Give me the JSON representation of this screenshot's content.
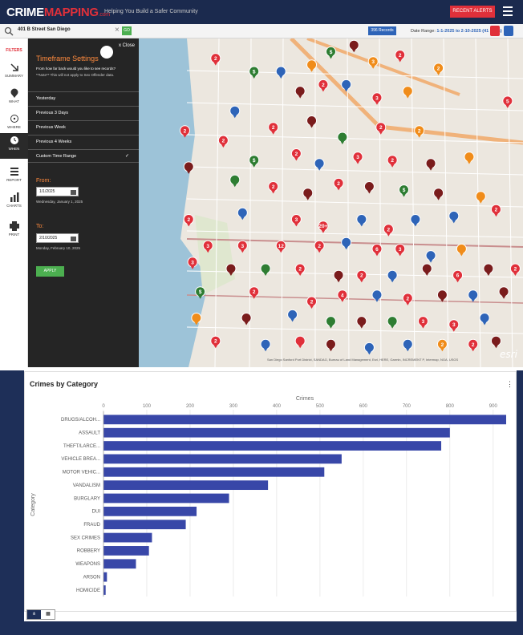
{
  "header": {
    "logo_crime": "CRIME",
    "logo_mapping": "MAPPING",
    "logo_com": ".com",
    "tagline": "Helping You Build a Safer Community",
    "recent_alerts_label": "RECENT ALERTS"
  },
  "search": {
    "value": "401 B Street San Diego",
    "clear": "×",
    "go_label": "GO",
    "records_label": "396 Records",
    "date_range_label": "Date Range:",
    "date_range_value": "1-1-2025 to 2-10-2025 (41 Days)"
  },
  "nav": {
    "filters": "FILTERS",
    "summary": "SUMMARY",
    "what": "WHAT",
    "where": "WHERE",
    "when": "WHEN",
    "report": "REPORT",
    "charts": "CHARTS",
    "print": "PRINT"
  },
  "timeframe": {
    "title": "Timeframe Settings",
    "close": "x Close",
    "question": "From how far back would you like to see records?",
    "note": "**Note** This will not apply to Sex Offender data.",
    "options": [
      "Yesterday",
      "Previous 3 Days",
      "Previous Week",
      "Previous 4 Weeks",
      "Custom Time Range"
    ],
    "check": "✓",
    "from_label": "From:",
    "from_value": "1/1/2025",
    "from_desc": "Wednesday, January 1, 2025",
    "to_label": "To:",
    "to_value": "2/10/2025",
    "to_desc": "Monday, February 10, 2025",
    "apply_label": "APPLY"
  },
  "map": {
    "attribution": "San Diego Sanford Port District, SANDAG, Bureau of Land Management, Esri, HERE, Garmin, INCREMENT P, Intermap, NGA, USGS",
    "esri": "esri",
    "markers": [
      {
        "x": 0.2,
        "y": 0.06,
        "c": "#e0303a",
        "t": "2"
      },
      {
        "x": 0.3,
        "y": 0.1,
        "c": "#2e7d32",
        "t": "$"
      },
      {
        "x": 0.37,
        "y": 0.1,
        "c": "#2e64b8",
        "t": ""
      },
      {
        "x": 0.45,
        "y": 0.08,
        "c": "#f08c1a",
        "t": ""
      },
      {
        "x": 0.5,
        "y": 0.04,
        "c": "#2e7d32",
        "t": "$"
      },
      {
        "x": 0.56,
        "y": 0.02,
        "c": "#7a1c1c",
        "t": ""
      },
      {
        "x": 0.61,
        "y": 0.07,
        "c": "#f08c1a",
        "t": "3"
      },
      {
        "x": 0.68,
        "y": 0.05,
        "c": "#e0303a",
        "t": "2"
      },
      {
        "x": 0.42,
        "y": 0.16,
        "c": "#7a1c1c",
        "t": ""
      },
      {
        "x": 0.48,
        "y": 0.14,
        "c": "#e0303a",
        "t": "2"
      },
      {
        "x": 0.54,
        "y": 0.14,
        "c": "#2e64b8",
        "t": ""
      },
      {
        "x": 0.62,
        "y": 0.18,
        "c": "#e0303a",
        "t": "3"
      },
      {
        "x": 0.7,
        "y": 0.16,
        "c": "#f08c1a",
        "t": ""
      },
      {
        "x": 0.78,
        "y": 0.09,
        "c": "#f08c1a",
        "t": "2"
      },
      {
        "x": 0.96,
        "y": 0.19,
        "c": "#e0303a",
        "t": "5"
      },
      {
        "x": 0.25,
        "y": 0.22,
        "c": "#2e64b8",
        "t": ""
      },
      {
        "x": 0.35,
        "y": 0.27,
        "c": "#e0303a",
        "t": "2"
      },
      {
        "x": 0.45,
        "y": 0.25,
        "c": "#7a1c1c",
        "t": ""
      },
      {
        "x": 0.53,
        "y": 0.3,
        "c": "#2e7d32",
        "t": ""
      },
      {
        "x": 0.63,
        "y": 0.27,
        "c": "#e0303a",
        "t": "2"
      },
      {
        "x": 0.73,
        "y": 0.28,
        "c": "#f08c1a",
        "t": "2"
      },
      {
        "x": 0.12,
        "y": 0.28,
        "c": "#e0303a",
        "t": "2"
      },
      {
        "x": 0.22,
        "y": 0.31,
        "c": "#e0303a",
        "t": "2"
      },
      {
        "x": 0.3,
        "y": 0.37,
        "c": "#2e7d32",
        "t": "$"
      },
      {
        "x": 0.41,
        "y": 0.35,
        "c": "#e0303a",
        "t": "2"
      },
      {
        "x": 0.47,
        "y": 0.38,
        "c": "#2e64b8",
        "t": ""
      },
      {
        "x": 0.57,
        "y": 0.36,
        "c": "#e0303a",
        "t": "3"
      },
      {
        "x": 0.66,
        "y": 0.37,
        "c": "#e0303a",
        "t": "2"
      },
      {
        "x": 0.76,
        "y": 0.38,
        "c": "#7a1c1c",
        "t": ""
      },
      {
        "x": 0.86,
        "y": 0.36,
        "c": "#f08c1a",
        "t": ""
      },
      {
        "x": 0.13,
        "y": 0.39,
        "c": "#7a1c1c",
        "t": ""
      },
      {
        "x": 0.25,
        "y": 0.43,
        "c": "#2e7d32",
        "t": ""
      },
      {
        "x": 0.35,
        "y": 0.45,
        "c": "#e0303a",
        "t": "2"
      },
      {
        "x": 0.44,
        "y": 0.47,
        "c": "#7a1c1c",
        "t": ""
      },
      {
        "x": 0.52,
        "y": 0.44,
        "c": "#e0303a",
        "t": "2"
      },
      {
        "x": 0.6,
        "y": 0.45,
        "c": "#7a1c1c",
        "t": ""
      },
      {
        "x": 0.69,
        "y": 0.46,
        "c": "#2e7d32",
        "t": "$"
      },
      {
        "x": 0.78,
        "y": 0.47,
        "c": "#7a1c1c",
        "t": ""
      },
      {
        "x": 0.89,
        "y": 0.48,
        "c": "#f08c1a",
        "t": ""
      },
      {
        "x": 0.27,
        "y": 0.53,
        "c": "#2e64b8",
        "t": ""
      },
      {
        "x": 0.41,
        "y": 0.55,
        "c": "#e0303a",
        "t": "3"
      },
      {
        "x": 0.48,
        "y": 0.57,
        "c": "#e0303a",
        "t": "20+"
      },
      {
        "x": 0.58,
        "y": 0.55,
        "c": "#2e64b8",
        "t": ""
      },
      {
        "x": 0.65,
        "y": 0.58,
        "c": "#e0303a",
        "t": "2"
      },
      {
        "x": 0.72,
        "y": 0.55,
        "c": "#2e64b8",
        "t": ""
      },
      {
        "x": 0.82,
        "y": 0.54,
        "c": "#2e64b8",
        "t": ""
      },
      {
        "x": 0.93,
        "y": 0.52,
        "c": "#e0303a",
        "t": "2"
      },
      {
        "x": 0.13,
        "y": 0.55,
        "c": "#e0303a",
        "t": "2"
      },
      {
        "x": 0.18,
        "y": 0.63,
        "c": "#e0303a",
        "t": "3"
      },
      {
        "x": 0.27,
        "y": 0.63,
        "c": "#e0303a",
        "t": "3"
      },
      {
        "x": 0.37,
        "y": 0.63,
        "c": "#e0303a",
        "t": "12"
      },
      {
        "x": 0.47,
        "y": 0.63,
        "c": "#e0303a",
        "t": "2"
      },
      {
        "x": 0.54,
        "y": 0.62,
        "c": "#2e64b8",
        "t": ""
      },
      {
        "x": 0.62,
        "y": 0.64,
        "c": "#e0303a",
        "t": "6"
      },
      {
        "x": 0.68,
        "y": 0.64,
        "c": "#e0303a",
        "t": "3"
      },
      {
        "x": 0.76,
        "y": 0.66,
        "c": "#2e64b8",
        "t": ""
      },
      {
        "x": 0.84,
        "y": 0.64,
        "c": "#f08c1a",
        "t": ""
      },
      {
        "x": 0.14,
        "y": 0.68,
        "c": "#e0303a",
        "t": "3"
      },
      {
        "x": 0.24,
        "y": 0.7,
        "c": "#7a1c1c",
        "t": ""
      },
      {
        "x": 0.33,
        "y": 0.7,
        "c": "#2e7d32",
        "t": ""
      },
      {
        "x": 0.42,
        "y": 0.7,
        "c": "#e0303a",
        "t": "2"
      },
      {
        "x": 0.52,
        "y": 0.72,
        "c": "#7a1c1c",
        "t": ""
      },
      {
        "x": 0.58,
        "y": 0.72,
        "c": "#e0303a",
        "t": "2"
      },
      {
        "x": 0.66,
        "y": 0.72,
        "c": "#2e64b8",
        "t": ""
      },
      {
        "x": 0.75,
        "y": 0.7,
        "c": "#7a1c1c",
        "t": ""
      },
      {
        "x": 0.83,
        "y": 0.72,
        "c": "#e0303a",
        "t": "6"
      },
      {
        "x": 0.91,
        "y": 0.7,
        "c": "#7a1c1c",
        "t": ""
      },
      {
        "x": 0.98,
        "y": 0.7,
        "c": "#e0303a",
        "t": "2"
      },
      {
        "x": 0.16,
        "y": 0.77,
        "c": "#2e7d32",
        "t": "$"
      },
      {
        "x": 0.3,
        "y": 0.77,
        "c": "#e0303a",
        "t": "2"
      },
      {
        "x": 0.45,
        "y": 0.8,
        "c": "#e0303a",
        "t": "2"
      },
      {
        "x": 0.53,
        "y": 0.78,
        "c": "#e0303a",
        "t": "4"
      },
      {
        "x": 0.62,
        "y": 0.78,
        "c": "#2e64b8",
        "t": ""
      },
      {
        "x": 0.7,
        "y": 0.79,
        "c": "#e0303a",
        "t": "2"
      },
      {
        "x": 0.79,
        "y": 0.78,
        "c": "#7a1c1c",
        "t": ""
      },
      {
        "x": 0.87,
        "y": 0.78,
        "c": "#2e64b8",
        "t": ""
      },
      {
        "x": 0.95,
        "y": 0.77,
        "c": "#7a1c1c",
        "t": ""
      },
      {
        "x": 0.15,
        "y": 0.85,
        "c": "#f08c1a",
        "t": ""
      },
      {
        "x": 0.28,
        "y": 0.85,
        "c": "#7a1c1c",
        "t": ""
      },
      {
        "x": 0.4,
        "y": 0.84,
        "c": "#2e64b8",
        "t": ""
      },
      {
        "x": 0.5,
        "y": 0.86,
        "c": "#2e7d32",
        "t": ""
      },
      {
        "x": 0.58,
        "y": 0.86,
        "c": "#7a1c1c",
        "t": ""
      },
      {
        "x": 0.66,
        "y": 0.86,
        "c": "#2e7d32",
        "t": ""
      },
      {
        "x": 0.74,
        "y": 0.86,
        "c": "#e0303a",
        "t": "3"
      },
      {
        "x": 0.82,
        "y": 0.87,
        "c": "#e0303a",
        "t": "3"
      },
      {
        "x": 0.9,
        "y": 0.85,
        "c": "#2e64b8",
        "t": ""
      },
      {
        "x": 0.2,
        "y": 0.92,
        "c": "#e0303a",
        "t": "2"
      },
      {
        "x": 0.33,
        "y": 0.93,
        "c": "#2e64b8",
        "t": ""
      },
      {
        "x": 0.42,
        "y": 0.92,
        "c": "#e0303a",
        "t": ""
      },
      {
        "x": 0.5,
        "y": 0.93,
        "c": "#7a1c1c",
        "t": ""
      },
      {
        "x": 0.6,
        "y": 0.94,
        "c": "#2e64b8",
        "t": ""
      },
      {
        "x": 0.7,
        "y": 0.93,
        "c": "#2e64b8",
        "t": ""
      },
      {
        "x": 0.79,
        "y": 0.93,
        "c": "#f08c1a",
        "t": "2"
      },
      {
        "x": 0.87,
        "y": 0.93,
        "c": "#e0303a",
        "t": "2"
      },
      {
        "x": 0.93,
        "y": 0.92,
        "c": "#7a1c1c",
        "t": ""
      }
    ]
  },
  "chart": {
    "title": "Crimes by Category",
    "menu": "⋮",
    "bar_toggle": "ılı",
    "table_toggle": "▦"
  },
  "chart_data": {
    "type": "bar",
    "orientation": "horizontal",
    "title": "Crimes by Category",
    "xlabel": "Crimes",
    "ylabel": "Category",
    "xlim": [
      0,
      900
    ],
    "xticks": [
      0,
      100,
      200,
      300,
      400,
      500,
      600,
      700,
      800,
      900
    ],
    "categories": [
      "DRUGS/ALCOH...",
      "ASSAULT",
      "THEFT/LARCE...",
      "VEHICLE BREA...",
      "MOTOR VEHIC...",
      "VANDALISM",
      "BURGLARY",
      "DUI",
      "FRAUD",
      "SEX CRIMES",
      "ROBBERY",
      "WEAPONS",
      "ARSON",
      "HOMICIDE"
    ],
    "values": [
      930,
      800,
      780,
      550,
      510,
      380,
      290,
      215,
      190,
      112,
      105,
      75,
      8,
      5
    ],
    "color": "#3847a8",
    "grid": true
  }
}
